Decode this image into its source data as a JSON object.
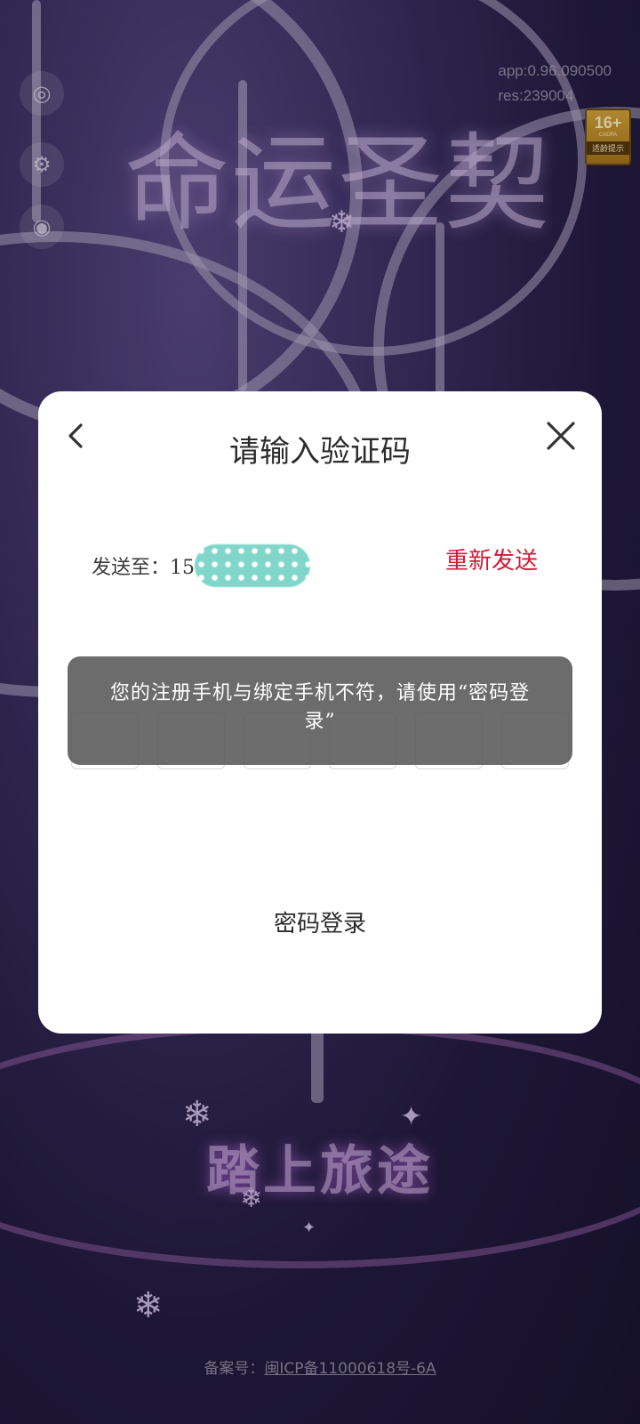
{
  "background": {
    "game_title": "命运圣契",
    "version_app": "app:0.96.090500",
    "version_res": "res:239004",
    "age_rating": {
      "number": "16+",
      "caption": "适龄提示",
      "org": "CADPA"
    },
    "start_button": "踏上旅途",
    "icp_prefix": "备案号：",
    "icp_number": "闽ICP备11000618号-6A"
  },
  "modal": {
    "title": "请输入验证码",
    "sent_to_label": "发送至：15",
    "resend_label": "重新发送",
    "code_box_count": 6,
    "toast_message": "您的注册手机与绑定手机不符，请使用“密码登录”",
    "password_login_label": "密码登录"
  },
  "icons": {
    "back": "chevron-left-icon",
    "close": "close-icon"
  },
  "colors": {
    "accent_red": "#d01a35",
    "modal_bg": "#ffffff",
    "toast_bg": "#5c5c5c",
    "mask_teal": "#7fd6c9"
  }
}
